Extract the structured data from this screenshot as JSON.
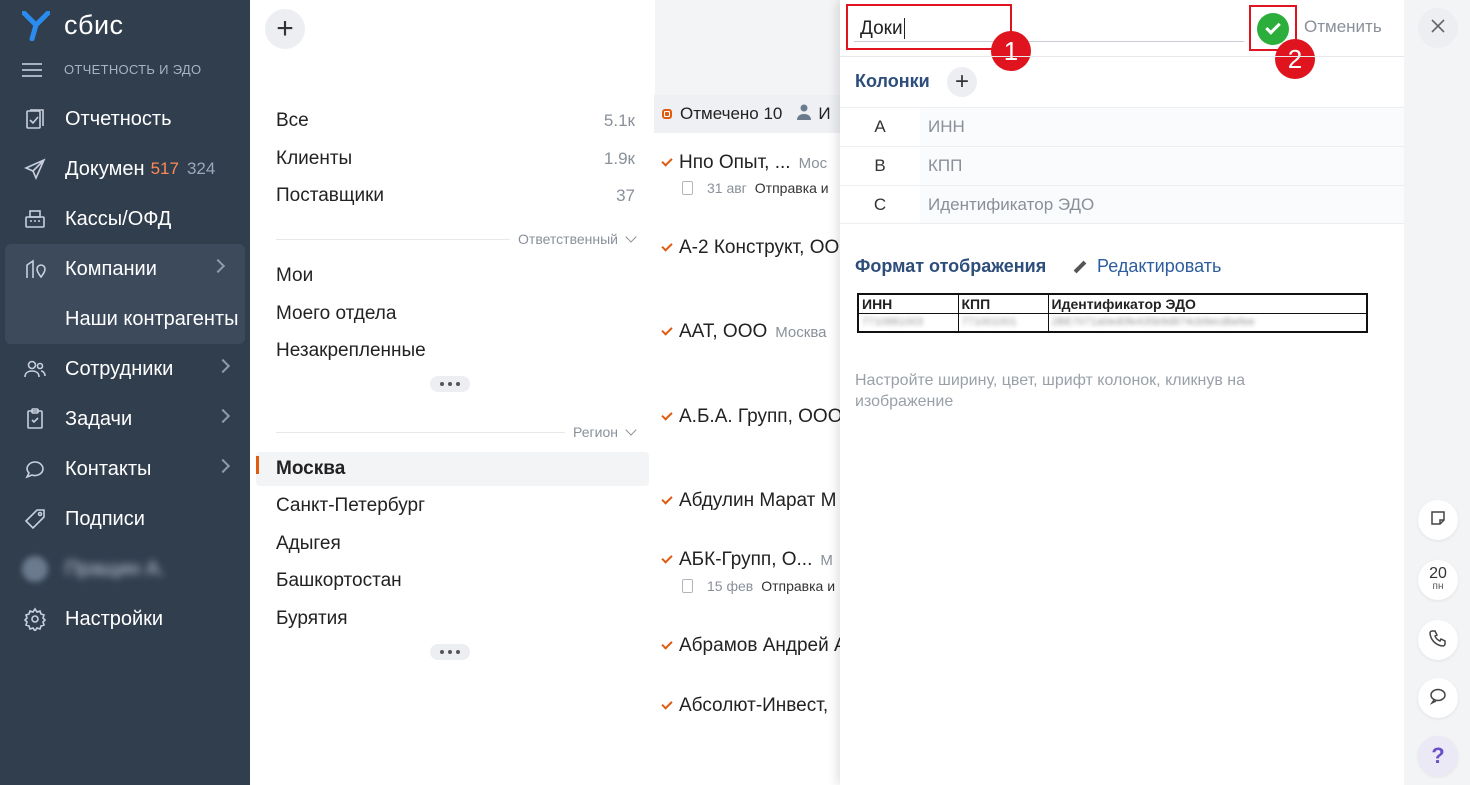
{
  "sidebar": {
    "logo_text": "сбис",
    "section_title": "ОТЧЕТНОСТЬ И ЭДО",
    "items": [
      {
        "label": "Отчетность",
        "icon": "report-icon"
      },
      {
        "label": "Докумен",
        "icon": "paper-plane-icon",
        "badge_red": "517",
        "badge_gray": "324"
      },
      {
        "label": "Кассы/ОФД",
        "icon": "cash-register-icon"
      },
      {
        "label": "Компании",
        "icon": "company-icon"
      },
      {
        "label": "Наши контрагенты"
      },
      {
        "label": "Сотрудники",
        "icon": "people-icon"
      },
      {
        "label": "Задачи",
        "icon": "clipboard-icon"
      },
      {
        "label": "Контакты",
        "icon": "chat-icon"
      },
      {
        "label": "Подписи",
        "icon": "tag-icon"
      },
      {
        "label": "Пращин А."
      },
      {
        "label": "Настройки",
        "icon": "gear-icon"
      }
    ]
  },
  "filters": {
    "groups": [
      {
        "label": "Все",
        "count": "5.1к"
      },
      {
        "label": "Клиенты",
        "count": "1.9к"
      },
      {
        "label": "Поставщики",
        "count": "37"
      }
    ],
    "responsible_header": "Ответственный",
    "responsible": [
      "Мои",
      "Моего отдела",
      "Незакрепленные"
    ],
    "region_header": "Регион",
    "regions": [
      "Москва",
      "Санкт-Петербург",
      "Адыгея",
      "Башкортостан",
      "Бурятия"
    ]
  },
  "list": {
    "header": "Отмечено 10",
    "header_extra": "И",
    "items": [
      {
        "name": "Нпо Опыт, ...",
        "city": "Мос",
        "sub_date": "31 авг",
        "sub_text": "Отправка и"
      },
      {
        "name": "А-2 Конструкт, ОО"
      },
      {
        "name": "ААТ, ООО",
        "city": "Москва"
      },
      {
        "name": "А.Б.А. Групп, ООО"
      },
      {
        "name": "Абдулин Марат М"
      },
      {
        "name": "АБК-Групп, О...",
        "city": "М",
        "sub_date": "15 фев",
        "sub_text": "Отправка и"
      },
      {
        "name": "Абрамов Андрей А"
      },
      {
        "name": "Абсолют-Инвест,"
      }
    ]
  },
  "panel": {
    "name_value": "Доки",
    "annot1": "1",
    "annot2": "2",
    "cancel_label": "Отменить",
    "columns_title": "Колонки",
    "columns": [
      {
        "letter": "A",
        "name": "ИНН"
      },
      {
        "letter": "B",
        "name": "КПП"
      },
      {
        "letter": "C",
        "name": "Идентификатор ЭДО"
      }
    ],
    "format_title": "Формат отображения",
    "edit_label": "Редактировать",
    "preview_headers": [
      "ИНН",
      "КПП",
      "Идентификатор ЭДО"
    ],
    "preview_values": [
      "7710881003",
      "771001001",
      "2BE7071a0ed0fe435b9d874cb9ecdbefee"
    ],
    "hint": "Настройте ширину, цвет, шрифт колонок, кликнув на изображение"
  },
  "rail": {
    "calendar_day": "20",
    "calendar_weekday": "пн",
    "help_label": "?"
  },
  "colors": {
    "sidebar_bg": "#313e4e",
    "accent_orange": "#e05a10",
    "ok_green": "#2cae3c",
    "annotation_red": "#e0141e",
    "title_blue": "#2d4d7a"
  }
}
